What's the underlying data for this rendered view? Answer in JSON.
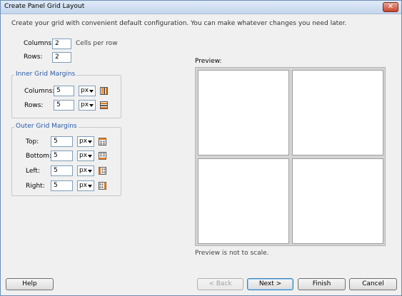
{
  "window": {
    "title": "Create Panel Grid Layout",
    "close_glyph": "✕"
  },
  "intro": "Create your grid with convenient default configuration. You can make whatever changes you need later.",
  "grid": {
    "columns_label": "Columns:",
    "columns_value": "2",
    "cells_hint": "Cells per row",
    "rows_label": "Rows:",
    "rows_value": "2"
  },
  "inner_margins": {
    "title": "Inner Grid Margins",
    "columns_label": "Columns:",
    "columns_value": "5",
    "columns_unit": "px",
    "rows_label": "Rows:",
    "rows_value": "5",
    "rows_unit": "px"
  },
  "outer_margins": {
    "title": "Outer Grid Margins",
    "top_label": "Top:",
    "top_value": "5",
    "top_unit": "px",
    "bottom_label": "Bottom:",
    "bottom_value": "5",
    "bottom_unit": "px",
    "left_label": "Left:",
    "left_value": "5",
    "left_unit": "px",
    "right_label": "Right:",
    "right_value": "5",
    "right_unit": "px"
  },
  "preview": {
    "label": "Preview:",
    "note": "Preview is not to scale."
  },
  "buttons": {
    "help": "Help",
    "back": "< Back",
    "next": "Next >",
    "finish": "Finish",
    "cancel": "Cancel"
  },
  "colors": {
    "accent_orange": "#e07a1e",
    "group_title": "#2a5aa8"
  }
}
